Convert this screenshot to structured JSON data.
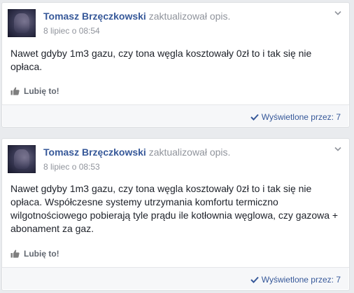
{
  "posts": [
    {
      "author": "Tomasz Brzęczkowski",
      "action": "zaktualizował opis.",
      "date": "8 lipiec o 08:54",
      "lines": [
        "Nawet gdyby 1m3 gazu, czy tona węgla kosztowały 0zł to i tak się nie",
        "opłaca."
      ],
      "like_label": "Lubię to!",
      "seen_label": "Wyświetlone przez: 7"
    },
    {
      "author": "Tomasz Brzęczkowski",
      "action": "zaktualizował opis.",
      "date": "8 lipiec o 08:53",
      "lines": [
        "Nawet gdyby 1m3 gazu, czy tona węgla kosztowały 0zł to i tak się nie",
        "opłaca. Współczesne systemy utrzymania komfortu termiczno",
        "wilgotnościowego pobierają tyle prądu ile kotłownia węglowa, czy gazowa +",
        "abonament za gaz."
      ],
      "like_label": "Lubię to!",
      "seen_label": "Wyświetlone przez: 7"
    }
  ],
  "colors": {
    "page_bg": "#e9ebee",
    "link_blue": "#365899",
    "meta_gray": "#90949c",
    "text": "#1d2129"
  }
}
